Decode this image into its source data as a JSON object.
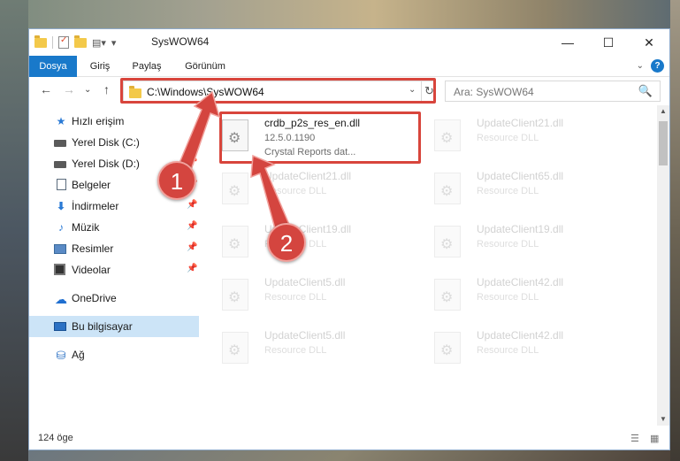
{
  "window": {
    "title": "SysWOW64",
    "minimize": "—",
    "maximize": "☐",
    "close": "✕"
  },
  "ribbon": {
    "tabs": [
      "Dosya",
      "Giriş",
      "Paylaş",
      "Görünüm"
    ],
    "active_tab": "Dosya",
    "help": "?",
    "expand": "⌄"
  },
  "navigation": {
    "back": "←",
    "forward": "→",
    "recent": "⌄",
    "up": "↑",
    "address": "C:\\Windows\\SysWOW64",
    "dropdown": "⌄",
    "refresh": "↻",
    "search_placeholder": "Ara: SysWOW64",
    "search_icon": "🔍"
  },
  "sidebar": {
    "items": [
      {
        "label": "Hızlı erişim",
        "icon": "star-icon"
      },
      {
        "label": "Yerel Disk (C:)",
        "icon": "drive-icon",
        "pinned": true
      },
      {
        "label": "Yerel Disk (D:)",
        "icon": "drive-icon",
        "pinned": true
      },
      {
        "label": "Belgeler",
        "icon": "documents-icon",
        "pinned": true
      },
      {
        "label": "İndirmeler",
        "icon": "downloads-icon",
        "pinned": true
      },
      {
        "label": "Müzik",
        "icon": "music-icon",
        "pinned": true
      },
      {
        "label": "Resimler",
        "icon": "pictures-icon",
        "pinned": true
      },
      {
        "label": "Videolar",
        "icon": "videos-icon",
        "pinned": true
      },
      {
        "label": "OneDrive",
        "icon": "onedrive-icon"
      },
      {
        "label": "Bu bilgisayar",
        "icon": "this-pc-icon",
        "selected": true
      },
      {
        "label": "Ağ",
        "icon": "network-icon"
      }
    ]
  },
  "files": [
    {
      "name": "crdb_p2s_res_en.dll",
      "line2": "12.5.0.1190",
      "line3": "Crystal Reports dat...",
      "highlighted": true
    },
    {
      "name": "UpdateClient21.dll",
      "line2": "Resource DLL"
    },
    {
      "name": "UpdateClient21.dll",
      "line2": "Resource DLL"
    },
    {
      "name": "UpdateClient65.dll",
      "line2": "Resource DLL"
    },
    {
      "name": "UpdateClient19.dll",
      "line2": "Resource DLL"
    },
    {
      "name": "UpdateClient19.dll",
      "line2": "Resource DLL"
    },
    {
      "name": "UpdateClient5.dll",
      "line2": "Resource DLL"
    },
    {
      "name": "UpdateClient42.dll",
      "line2": "Resource DLL"
    },
    {
      "name": "UpdateClient5.dll",
      "line2": "Resource DLL"
    },
    {
      "name": "UpdateClient42.dll",
      "line2": "Resource DLL"
    }
  ],
  "status": {
    "item_count": "124 öge"
  },
  "annotations": {
    "callout_1": "1",
    "callout_2": "2",
    "color": "#d4453f"
  }
}
